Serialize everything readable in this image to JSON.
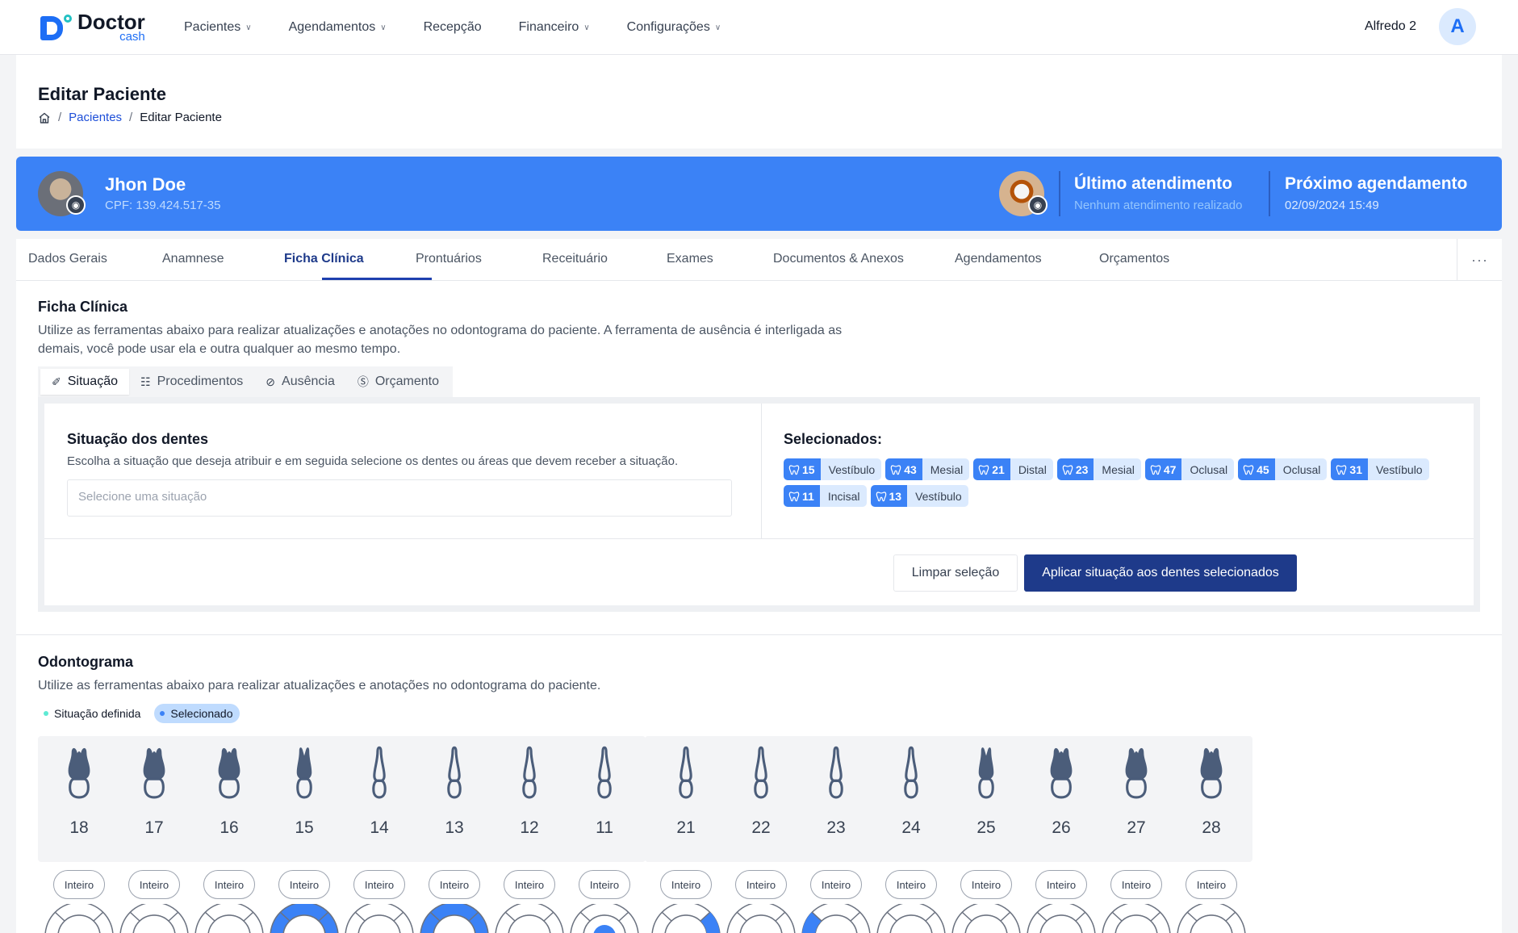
{
  "brand": {
    "name": "Doctor",
    "sub": "cash"
  },
  "nav": {
    "items": [
      {
        "label": "Pacientes",
        "dropdown": true
      },
      {
        "label": "Agendamentos",
        "dropdown": true
      },
      {
        "label": "Recepção",
        "dropdown": false
      },
      {
        "label": "Financeiro",
        "dropdown": true
      },
      {
        "label": "Configurações",
        "dropdown": true
      }
    ],
    "user_name": "Alfredo 2",
    "user_initial": "A"
  },
  "page": {
    "title": "Editar Paciente",
    "breadcrumb": [
      "Pacientes",
      "Editar Paciente"
    ]
  },
  "patient": {
    "name": "Jhon Doe",
    "cpf": "CPF: 139.424.517-35",
    "last_title": "Último atendimento",
    "last_value": "Nenhum atendimento realizado",
    "next_title": "Próximo agendamento",
    "next_value": "02/09/2024 15:49"
  },
  "tabs": [
    "Dados Gerais",
    "Anamnese",
    "Ficha Clínica",
    "Prontuários",
    "Receituário",
    "Exames",
    "Documentos & Anexos",
    "Agendamentos",
    "Orçamentos"
  ],
  "active_tab": "Ficha Clínica",
  "tabs_more": "···",
  "ficha": {
    "title": "Ficha Clínica",
    "desc1": "Utilize as ferramentas abaixo para realizar atualizações e anotações no odontograma do paciente. A ferramenta de ausência é interligada as",
    "desc2": "demais, você pode usar ela e outra qualquer ao mesmo tempo.",
    "subtabs": [
      {
        "label": "Situação",
        "icon": "tag-icon"
      },
      {
        "label": "Procedimentos",
        "icon": "procedure-icon"
      },
      {
        "label": "Ausência",
        "icon": "eye-off-icon"
      },
      {
        "label": "Orçamento",
        "icon": "coin-icon"
      }
    ],
    "situacao_title": "Situação dos dentes",
    "situacao_desc": "Escolha a situação que deseja atribuir e em seguida selecione os dentes ou áreas que devem receber a situação.",
    "select_placeholder": "Selecione uma situação",
    "selected_title": "Selecionados:",
    "selected": [
      {
        "tooth": "15",
        "area": "Vestíbulo"
      },
      {
        "tooth": "43",
        "area": "Mesial"
      },
      {
        "tooth": "21",
        "area": "Distal"
      },
      {
        "tooth": "23",
        "area": "Mesial"
      },
      {
        "tooth": "47",
        "area": "Oclusal"
      },
      {
        "tooth": "45",
        "area": "Oclusal"
      },
      {
        "tooth": "31",
        "area": "Vestíbulo"
      },
      {
        "tooth": "11",
        "area": "Incisal"
      },
      {
        "tooth": "13",
        "area": "Vestíbulo"
      }
    ],
    "clear_label": "Limpar seleção",
    "apply_label": "Aplicar situação aos dentes selecionados"
  },
  "odontograma": {
    "title": "Odontograma",
    "desc": "Utilize as ferramentas abaixo para realizar atualizações e anotações no odontograma do paciente.",
    "legend_defined": "Situação definida",
    "legend_selected": "Selecionado",
    "teeth": [
      {
        "number": "18",
        "type": "molar",
        "state": "Inteiro",
        "highlight": "none"
      },
      {
        "number": "17",
        "type": "molar",
        "state": "Inteiro",
        "highlight": "none"
      },
      {
        "number": "16",
        "type": "molar",
        "state": "Inteiro",
        "highlight": "none"
      },
      {
        "number": "15",
        "type": "premolar",
        "state": "Inteiro",
        "highlight": "top"
      },
      {
        "number": "14",
        "type": "single",
        "state": "Inteiro",
        "highlight": "none"
      },
      {
        "number": "13",
        "type": "single",
        "state": "Inteiro",
        "highlight": "top"
      },
      {
        "number": "12",
        "type": "single",
        "state": "Inteiro",
        "highlight": "none"
      },
      {
        "number": "11",
        "type": "single",
        "state": "Inteiro",
        "highlight": "center"
      },
      {
        "number": "21",
        "type": "single",
        "state": "Inteiro",
        "highlight": "right"
      },
      {
        "number": "22",
        "type": "single",
        "state": "Inteiro",
        "highlight": "none"
      },
      {
        "number": "23",
        "type": "single",
        "state": "Inteiro",
        "highlight": "left"
      },
      {
        "number": "24",
        "type": "single",
        "state": "Inteiro",
        "highlight": "none"
      },
      {
        "number": "25",
        "type": "premolar",
        "state": "Inteiro",
        "highlight": "none"
      },
      {
        "number": "26",
        "type": "molar",
        "state": "Inteiro",
        "highlight": "none"
      },
      {
        "number": "27",
        "type": "molar",
        "state": "Inteiro",
        "highlight": "none"
      },
      {
        "number": "28",
        "type": "molar",
        "state": "Inteiro",
        "highlight": "none"
      }
    ]
  },
  "colors": {
    "primary": "#3b82f6",
    "dark": "#1e3a8a",
    "selected": "#3b82f6",
    "defined": "#5eead4"
  }
}
